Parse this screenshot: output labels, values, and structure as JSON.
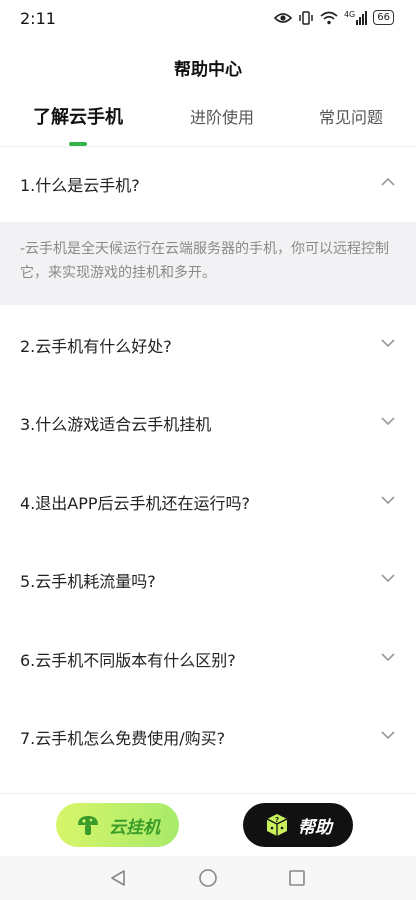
{
  "status": {
    "time": "2:11",
    "network": "4G",
    "battery": "66"
  },
  "header": {
    "title": "帮助中心"
  },
  "tabs": [
    {
      "label": "了解云手机",
      "active": true
    },
    {
      "label": "进阶使用",
      "active": false
    },
    {
      "label": "常见问题",
      "active": false
    }
  ],
  "faq": {
    "items": [
      {
        "question": "1.什么是云手机?",
        "expanded": true
      },
      {
        "question": "2.云手机有什么好处?",
        "expanded": false
      },
      {
        "question": "3.什么游戏适合云手机挂机",
        "expanded": false
      },
      {
        "question": "4.退出APP后云手机还在运行吗?",
        "expanded": false
      },
      {
        "question": "5.云手机耗流量吗?",
        "expanded": false
      },
      {
        "question": "6.云手机不同版本有什么区别?",
        "expanded": false
      },
      {
        "question": "7.云手机怎么免费使用/购买?",
        "expanded": false
      }
    ],
    "answer_1": "-云手机是全天候运行在云端服务器的手机，你可以远程控制它，来实现游戏的挂机和多开。"
  },
  "bottom": {
    "guaji_label": "云挂机",
    "help_label": "帮助"
  },
  "colors": {
    "accent": "#36b24a",
    "answer_bg": "#f2f2f4",
    "help_btn_bg": "#111111"
  },
  "icons": [
    "eye-icon",
    "vibrate-icon",
    "wifi-icon",
    "signal-icon",
    "battery-icon",
    "chevron-up-icon",
    "chevron-down-icon",
    "cloud-mushroom-icon",
    "dice-icon",
    "nav-back-icon",
    "nav-home-icon",
    "nav-recent-icon"
  ]
}
